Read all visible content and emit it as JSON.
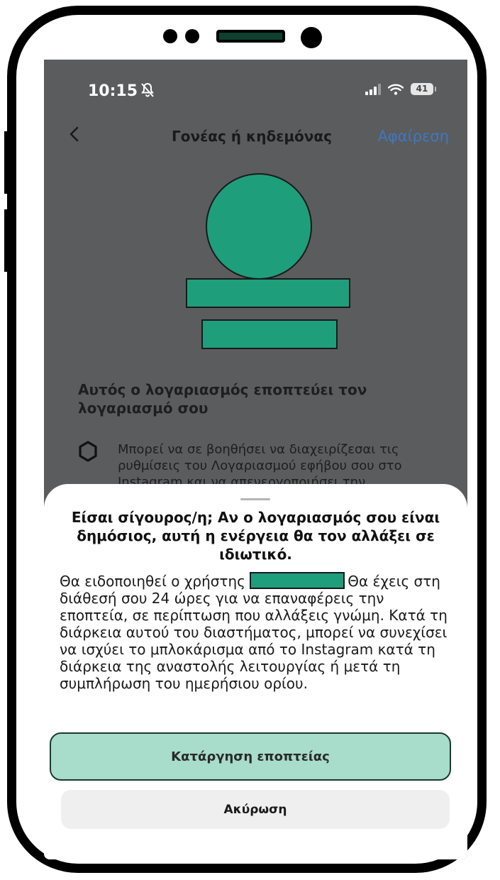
{
  "status_bar": {
    "time": "10:15",
    "battery": "41"
  },
  "nav": {
    "title": "Γονέας ή κηδεμόνας",
    "remove_label": "Αφαίρεση"
  },
  "section": {
    "title": "Αυτός ο λογαριασμός εποπτεύει τον λογαριασμό σου",
    "info_text": "Μπορεί να σε βοηθήσει να διαχειρίζεσαι τις ρυθμίσεις του Λογαριασμού εφήβου σου στο Instagram και να απενεργοποιήσει την"
  },
  "sheet": {
    "title": "Είσαι σίγουρος/η; Αν ο λογαριασμός σου είναι δημόσιος, αυτή η ενέργεια θα τον αλλάξει σε ιδιωτικό.",
    "body_prefix": "Θα ειδοποιηθεί ο χρήστης",
    "body_suffix": "Θα έχεις στη διάθεσή σου 24 ώρες για να επαναφέρεις την εποπτεία, σε περίπτωση που αλλάξεις γνώμη. Κατά τη διάρκεια αυτού του διαστήματος, μπορεί να συνεχίσει να ισχύει το μπλοκάρισμα από το Instagram κατά τη διάρκεια της αναστολής λειτουργίας ή μετά τη συμπλήρωση του ημερήσιου ορίου.",
    "primary_button": "Κατάργηση εποπτείας",
    "secondary_button": "Ακύρωση"
  },
  "icons": {
    "back": "chevron-left-icon",
    "bell_off": "bell-slash-icon",
    "signal": "signal-icon",
    "wifi": "wifi-icon",
    "settings": "gear-icon"
  },
  "colors": {
    "redaction": "#1f9e7c",
    "primary_button": "#a8dccb",
    "link": "#3e78c2",
    "screen_dim": "#5b5c5e"
  }
}
